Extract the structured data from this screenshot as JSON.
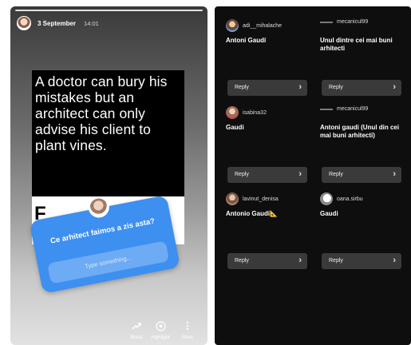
{
  "story": {
    "date": "3 September",
    "time": "14:01",
    "quote_text": "A doctor can bury his mistakes but an architect can only advise his client to plant vines.",
    "fragment": "F",
    "question": {
      "title": "Ce arhitect faimos a zis asta?",
      "placeholder": "Type something..."
    },
    "footer": {
      "boost": "Boost",
      "highlight": "Highlight",
      "more": "More"
    }
  },
  "replies": [
    {
      "user": "adi__mihalache",
      "answer": "Antoni Gaudí",
      "avatar": "av1",
      "reply_label": "Reply"
    },
    {
      "user": "mecanicul99",
      "answer": "Unul dintre cei mai buni arhitecti",
      "avatar": "mini",
      "reply_label": "Reply"
    },
    {
      "user": "isabina32",
      "answer": "Gaudi",
      "avatar": "av2",
      "reply_label": "Reply"
    },
    {
      "user": "mecanicul99",
      "answer": "Antoni gaudi (Unul din cei mai buni arhitecti)",
      "avatar": "mini",
      "reply_label": "Reply"
    },
    {
      "user": "lavinut_denisa",
      "answer": "Antonio Gaudi📐",
      "avatar": "av3",
      "reply_label": "Reply"
    },
    {
      "user": "oana.sirbu",
      "answer": "Gaudi",
      "avatar": "av4",
      "reply_label": "Reply"
    }
  ],
  "icons": {
    "chevron": "chevron-right-icon",
    "boost": "trend-up-icon",
    "highlight": "highlight-circle-icon",
    "more": "vertical-dots-icon"
  }
}
